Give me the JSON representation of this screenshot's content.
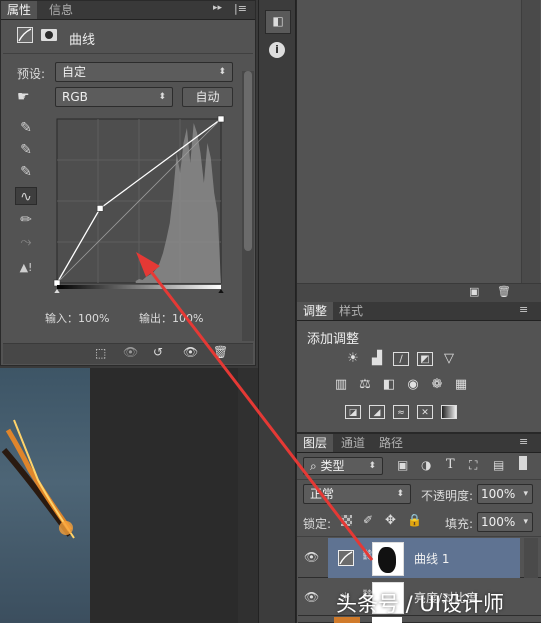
{
  "properties_panel": {
    "tabs": [
      "属性",
      "信息"
    ],
    "header_title": "曲线",
    "preset_label": "预设:",
    "preset_value": "自定",
    "channel_value": "RGB",
    "auto_button": "自动",
    "input_label": "输入：100%",
    "output_label": "输出：100%"
  },
  "adjustments_panel": {
    "tabs": [
      "调整",
      "样式"
    ],
    "add_adjustment_label": "添加调整"
  },
  "layers_panel": {
    "tabs": [
      "图层",
      "通道",
      "路径"
    ],
    "filter_kind": "类型",
    "blend_mode": "正常",
    "opacity_label": "不透明度:",
    "opacity_value": "100%",
    "lock_label": "锁定:",
    "fill_label": "填充:",
    "fill_value": "100%",
    "layers": [
      {
        "name": "曲线 1",
        "selected": true
      },
      {
        "name": "亮度/对比度",
        "selected": false
      }
    ]
  },
  "watermark": "头条号 / UI设计师",
  "colors": {
    "panel": "#535353",
    "selected_layer": "#5f7392",
    "annotation_arrow": "#e53935"
  },
  "chart_data": {
    "type": "line",
    "curve_points": [
      [
        0,
        0
      ],
      [
        67,
        116
      ],
      [
        255,
        255
      ]
    ],
    "xlim": [
      0,
      255
    ],
    "ylim": [
      0,
      255
    ]
  }
}
